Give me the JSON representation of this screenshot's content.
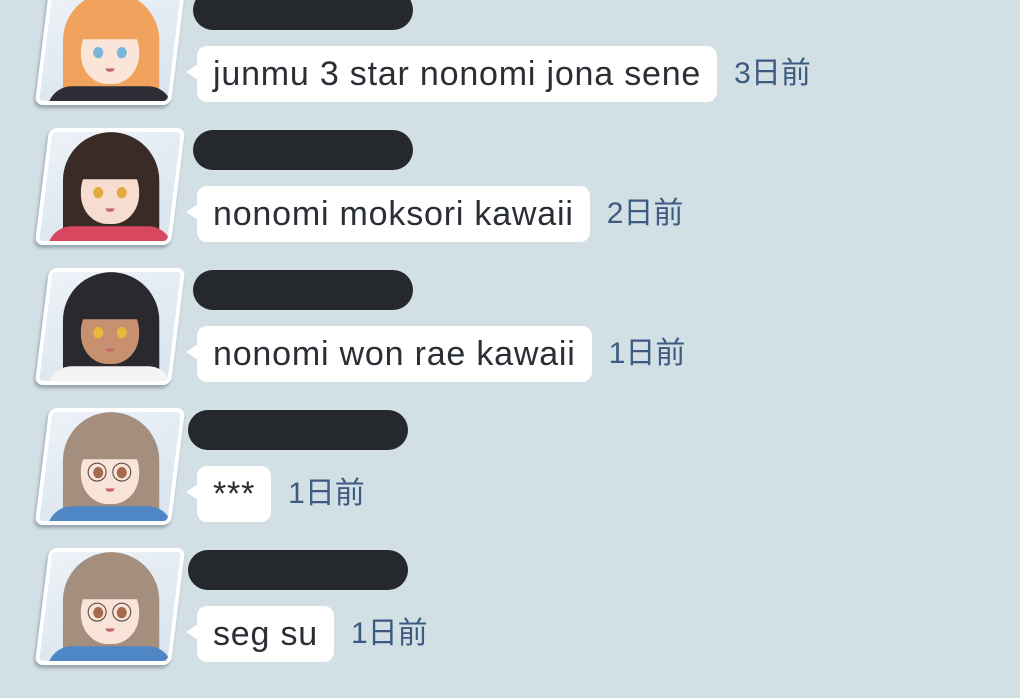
{
  "theme": {
    "background": "#d2dfe5",
    "bubble": "#ffffff",
    "message_text": "#2a2e35",
    "timestamp": "#3d5a80",
    "redaction": "#25282c",
    "avatar_border": "#ffffff"
  },
  "messages": [
    {
      "text": "junmu 3 star nonomi jona sene",
      "time": "3日前",
      "avatar": {
        "hair": "#f1a35e",
        "skin": "#fbe5d9",
        "eyes": "#7bb6d8",
        "outfit": "#2d2d35"
      }
    },
    {
      "text": "nonomi moksori kawaii",
      "time": "2日前",
      "avatar": {
        "hair": "#3b2b26",
        "skin": "#f7ddd0",
        "eyes": "#e2aa3c",
        "outfit": "#d9465f"
      }
    },
    {
      "text": "nonomi won rae kawaii",
      "time": "1日前",
      "avatar": {
        "hair": "#2a2930",
        "skin": "#c7906f",
        "eyes": "#e8b83c",
        "outfit": "#f4f4f4"
      }
    },
    {
      "text": "***",
      "time": "1日前",
      "avatar": {
        "hair": "#a48f7e",
        "skin": "#fae4d9",
        "eyes": "#a5694c",
        "outfit": "#4f86c6"
      }
    },
    {
      "text": "seg su",
      "time": "1日前",
      "avatar": {
        "hair": "#a48f7e",
        "skin": "#fae4d9",
        "eyes": "#a5694c",
        "outfit": "#4f86c6"
      }
    }
  ]
}
